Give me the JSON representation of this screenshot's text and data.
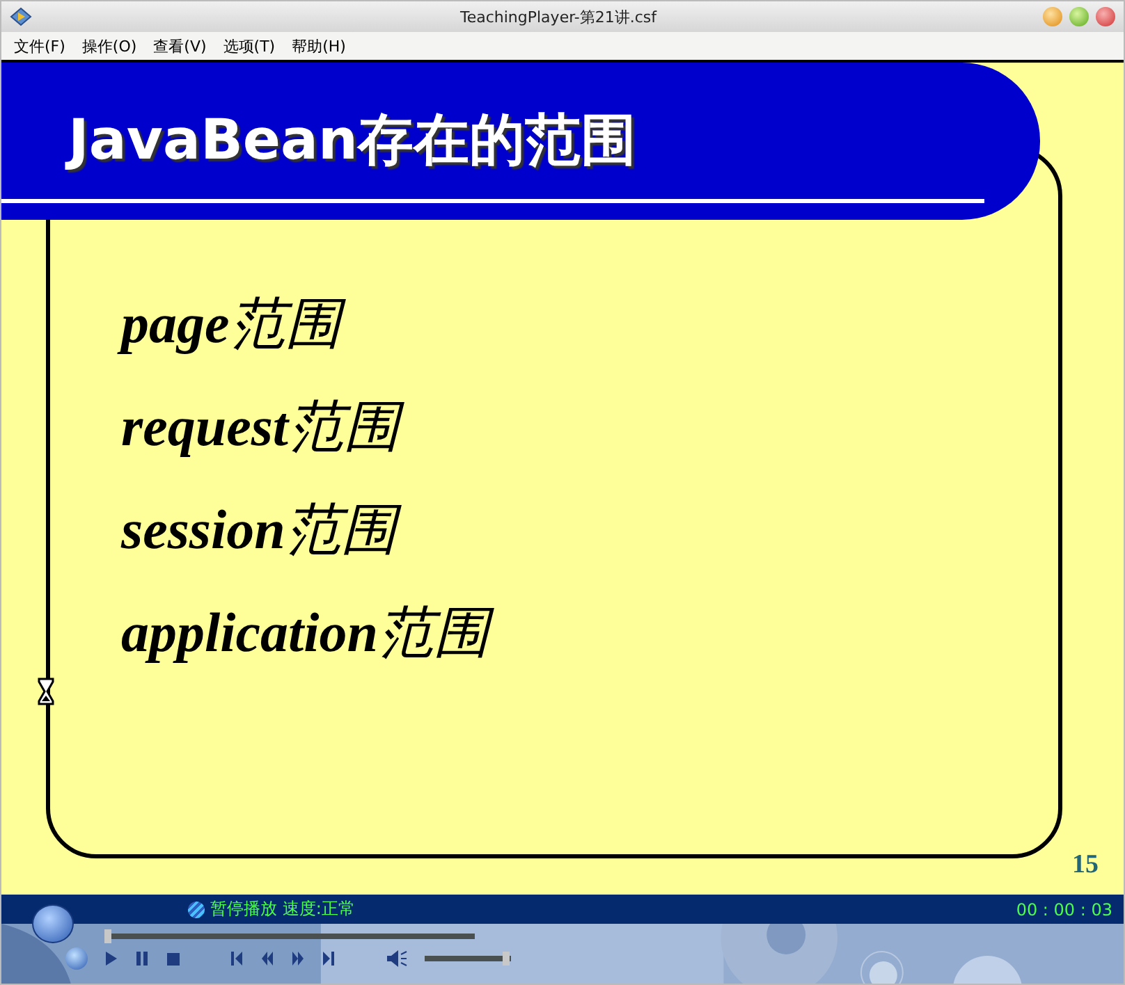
{
  "window": {
    "title": "TeachingPlayer-第21讲.csf"
  },
  "menu": [
    "文件(F)",
    "操作(O)",
    "查看(V)",
    "选项(T)",
    "帮助(H)"
  ],
  "slide": {
    "title": "JavaBean存在的范围",
    "bullets": [
      {
        "term": "page",
        "suffix": "范围"
      },
      {
        "term": "request",
        "suffix": "范围"
      },
      {
        "term": "session",
        "suffix": "范围"
      },
      {
        "term": "application",
        "suffix": "范围"
      }
    ],
    "page_number": "15"
  },
  "player": {
    "status": "暂停播放 速度:正常",
    "time": "00 : 00 : 03",
    "progress": {
      "level": 0.0
    },
    "volume": {
      "level": 1.0
    }
  }
}
